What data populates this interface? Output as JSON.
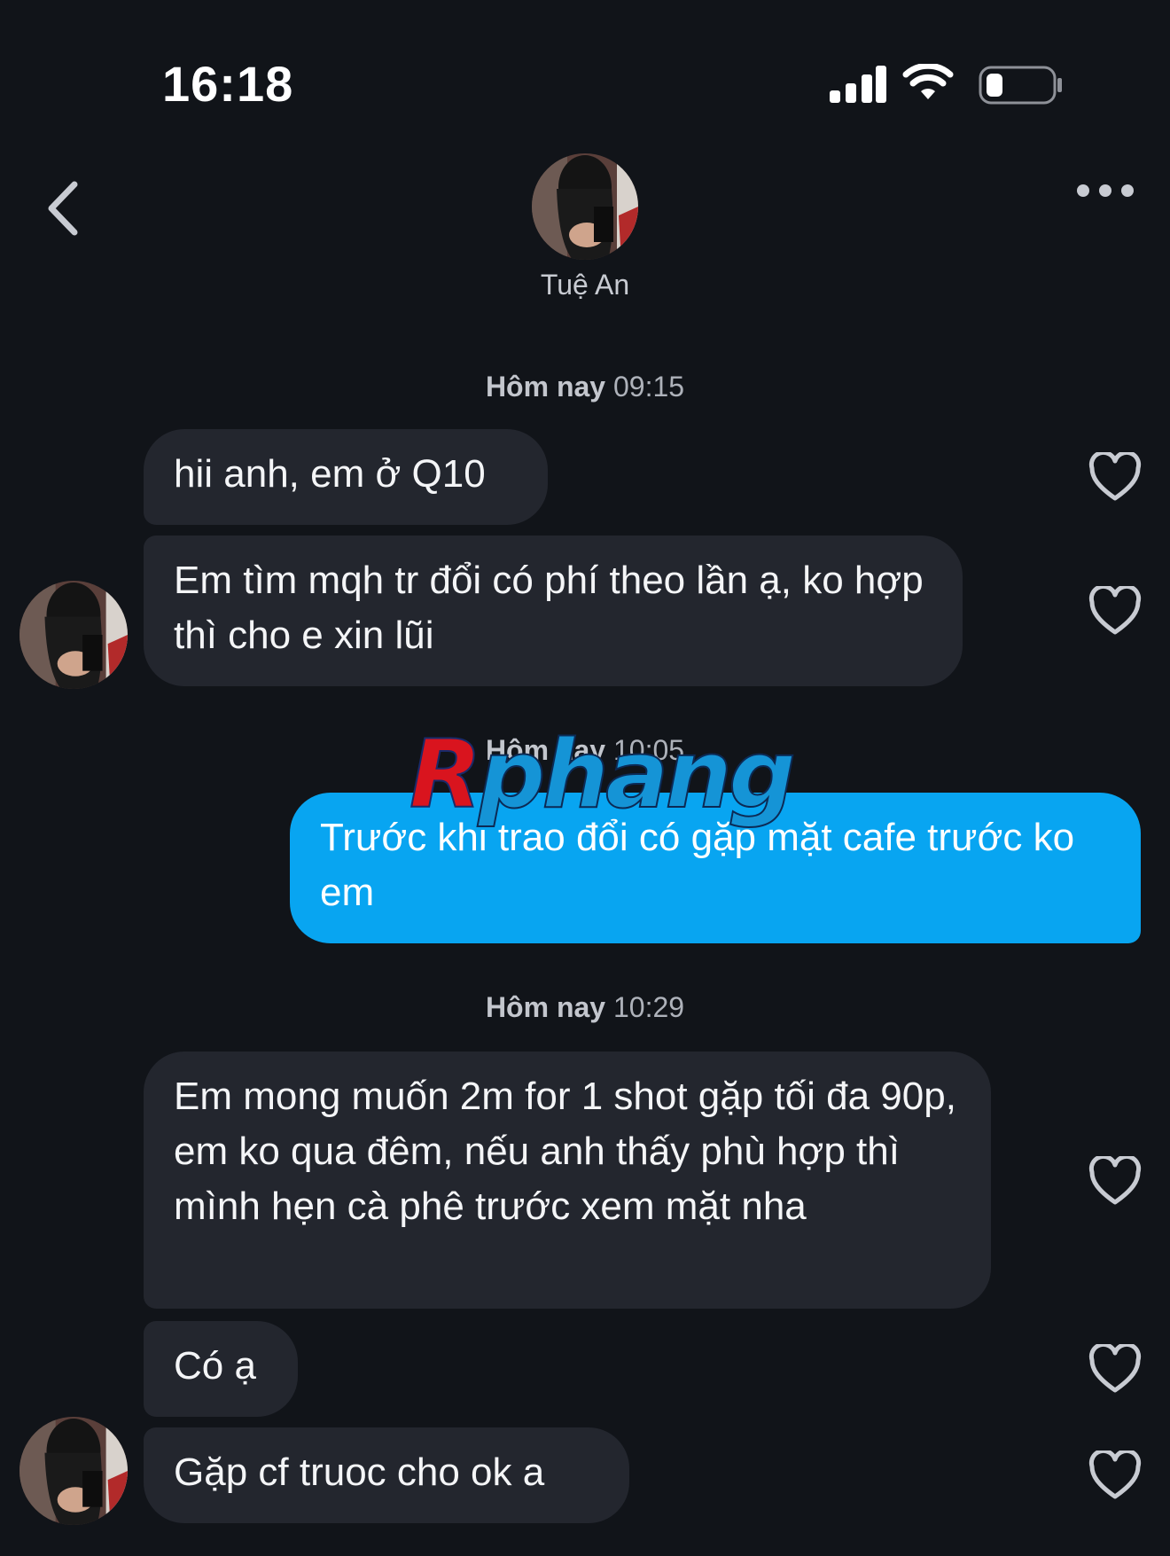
{
  "status_bar": {
    "time": "16:18"
  },
  "header": {
    "contact_name": "Tuệ An"
  },
  "conversation": {
    "groups": [
      {
        "timestamp_day": "Hôm nay",
        "timestamp_time": "09:15",
        "messages": [
          {
            "direction": "incoming",
            "text": "hii anh, em ở Q10"
          },
          {
            "direction": "incoming",
            "text": "Em tìm mqh tr đổi có phí theo lần ạ, ko hợp thì cho e xin lũi"
          }
        ]
      },
      {
        "timestamp_day": "Hôm nay",
        "timestamp_time": "10:05",
        "messages": [
          {
            "direction": "outgoing",
            "text": "Trước khi trao đổi có gặp mặt cafe trước ko em"
          }
        ]
      },
      {
        "timestamp_day": "Hôm nay",
        "timestamp_time": "10:29",
        "messages": [
          {
            "direction": "incoming",
            "text": "Em mong muốn 2m for 1 shot gặp tối đa 90p, em ko qua đêm, nếu anh thấy phù hợp thì mình hẹn cà phê trước xem mặt nha"
          },
          {
            "direction": "incoming",
            "text": "Có ạ"
          },
          {
            "direction": "incoming",
            "text": "Gặp cf truoc cho ok a"
          }
        ]
      }
    ]
  },
  "watermark": {
    "part1": "R",
    "part2": "phang"
  },
  "icons": {
    "back": "chevron-left-icon",
    "more": "more-dots-icon",
    "like": "heart-outline-icon"
  },
  "colors": {
    "background": "#111419",
    "incoming_bubble": "#23262e",
    "outgoing_bubble": "#08a5f1"
  }
}
